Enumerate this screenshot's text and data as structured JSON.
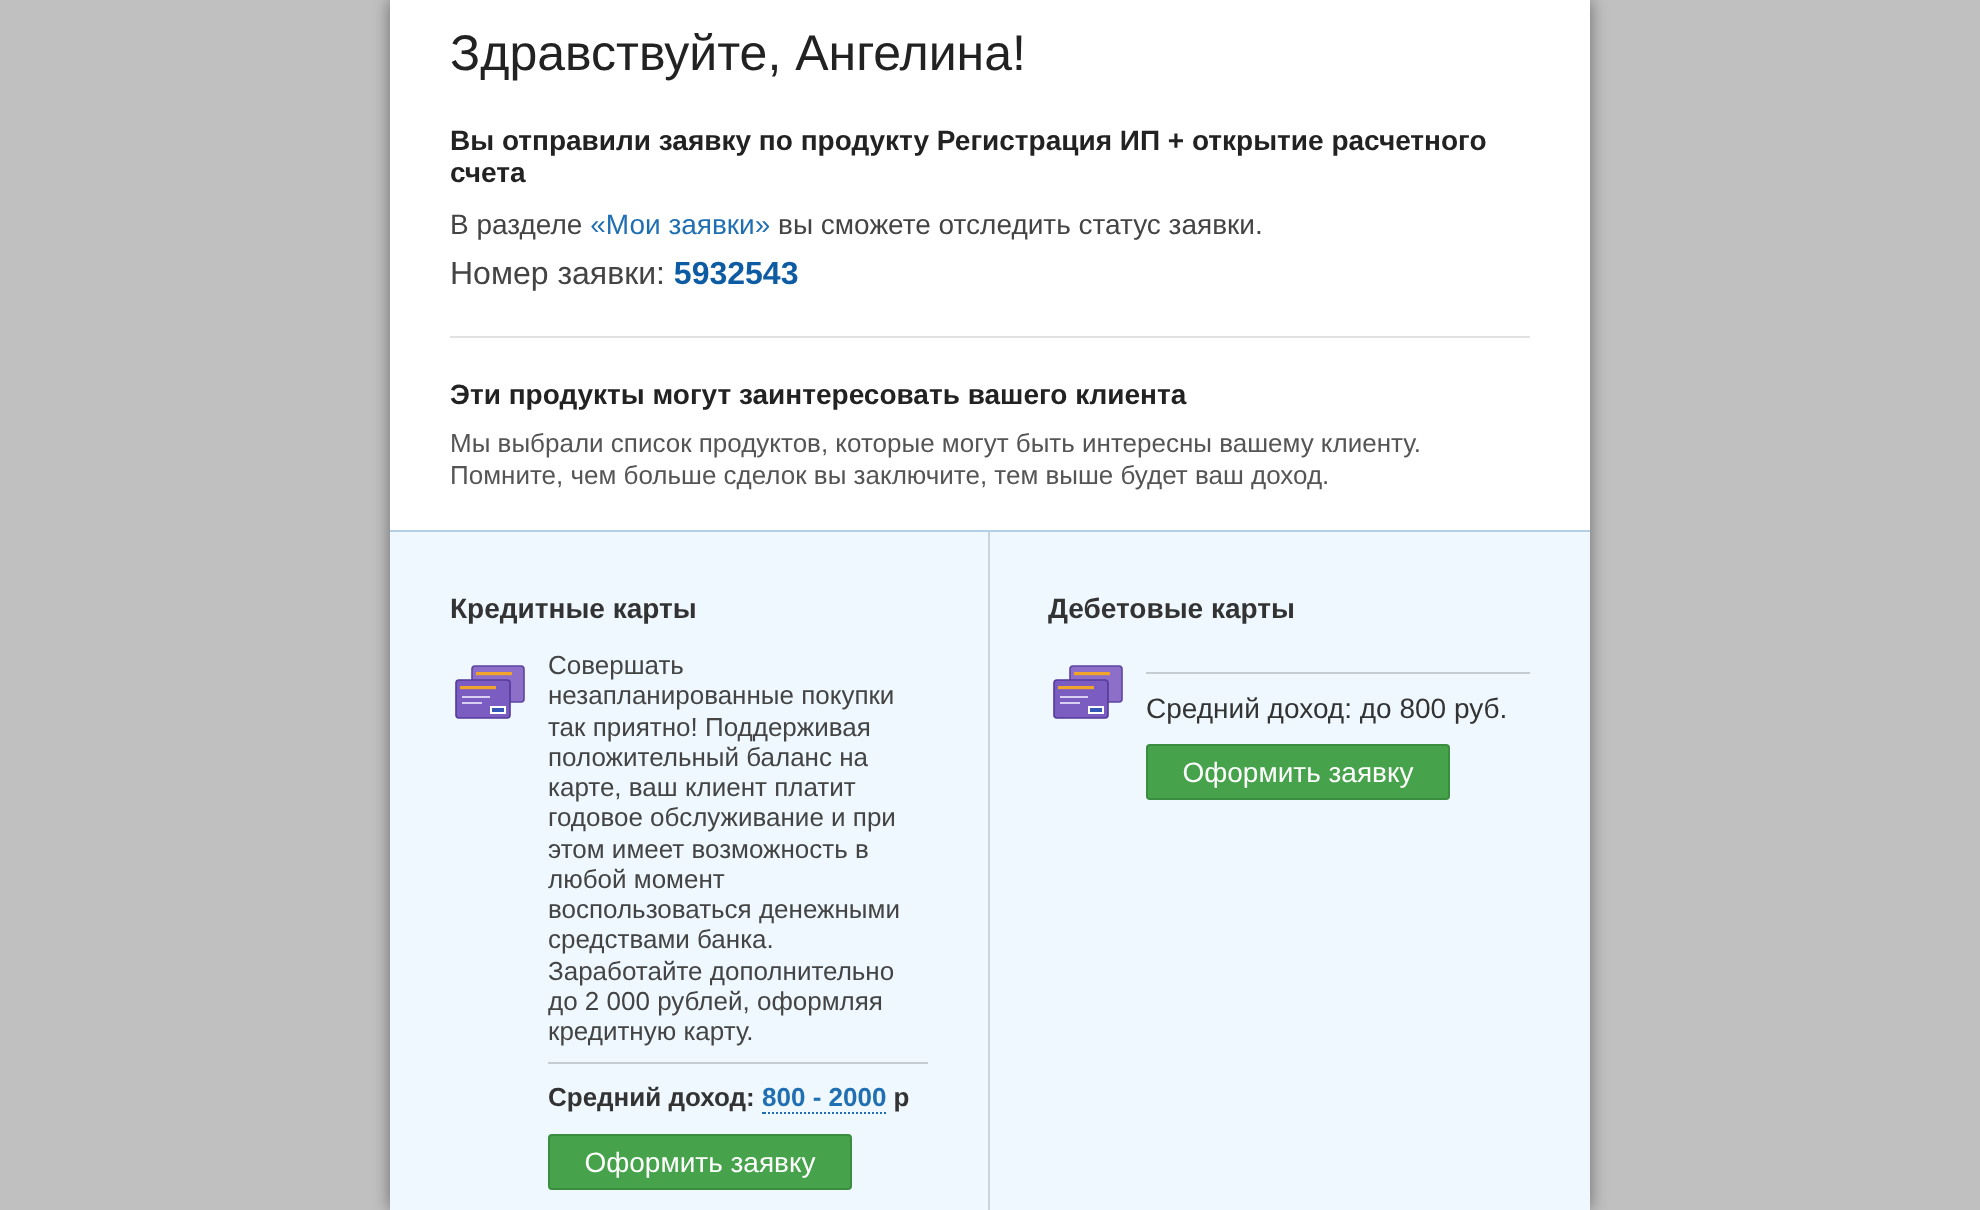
{
  "greeting": "Здравствуйте, Ангелина!",
  "request": {
    "message": "Вы отправили заявку по продукту Регистрация ИП + открытие расчетного счета",
    "status_before": "В разделе",
    "status_link": "«Мои заявки»",
    "status_after": "вы сможете отследить статус заявки.",
    "number_label": "Номер заявки:",
    "number": "5932543"
  },
  "recommendations": {
    "title": "Эти продукты могут заинтересовать вашего клиента",
    "description_lines": [
      "Мы выбрали список продуктов, которые могут быть интересны вашему клиенту.",
      "Помните, чем больше сделок вы заключите, тем выше будет ваш доход."
    ]
  },
  "products": [
    {
      "title": "Кредитные карты",
      "description": "Совершать незапланированные покупки так приятно! Поддерживая положительный баланс на карте, ваш клиент платит годовое обслуживание и при этом имеет возможность в любой момент воспользоваться денежными средствами банка. Заработайте дополнительно до 2 000 рублей, оформляя кредитную карту.",
      "income_label": "Средний доход:",
      "income_value": "800 - 2000",
      "income_unit": "р",
      "button": "Оформить заявку"
    },
    {
      "title": "Дебетовые карты",
      "income_label": "Средний доход: до 800 руб.",
      "button": "Оформить заявку"
    }
  ]
}
